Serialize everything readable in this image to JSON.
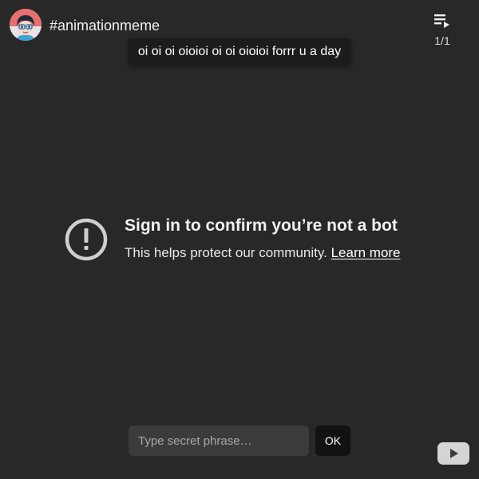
{
  "header": {
    "avatar_icon": "channel-avatar",
    "channel_title": "#animationmeme",
    "playlist_icon": "playlist-icon",
    "playlist_count": "1/1"
  },
  "tooltip": {
    "text": "oi oi oi oioioi oi oi oioioi forrr u a day"
  },
  "error": {
    "icon": "error-exclamation-icon",
    "title": "Sign in to confirm you’re not a bot",
    "message": "This helps protect our community.",
    "link_label": "Learn more"
  },
  "secret_form": {
    "value": "",
    "placeholder": "Type secret phrase…",
    "ok_label": "OK"
  },
  "footer": {
    "logo_icon": "youtube-logo-icon"
  },
  "colors": {
    "background": "#282828",
    "input_background": "#3b3b3b",
    "button_background": "#121212",
    "icon_gray": "#cfcfcf"
  }
}
